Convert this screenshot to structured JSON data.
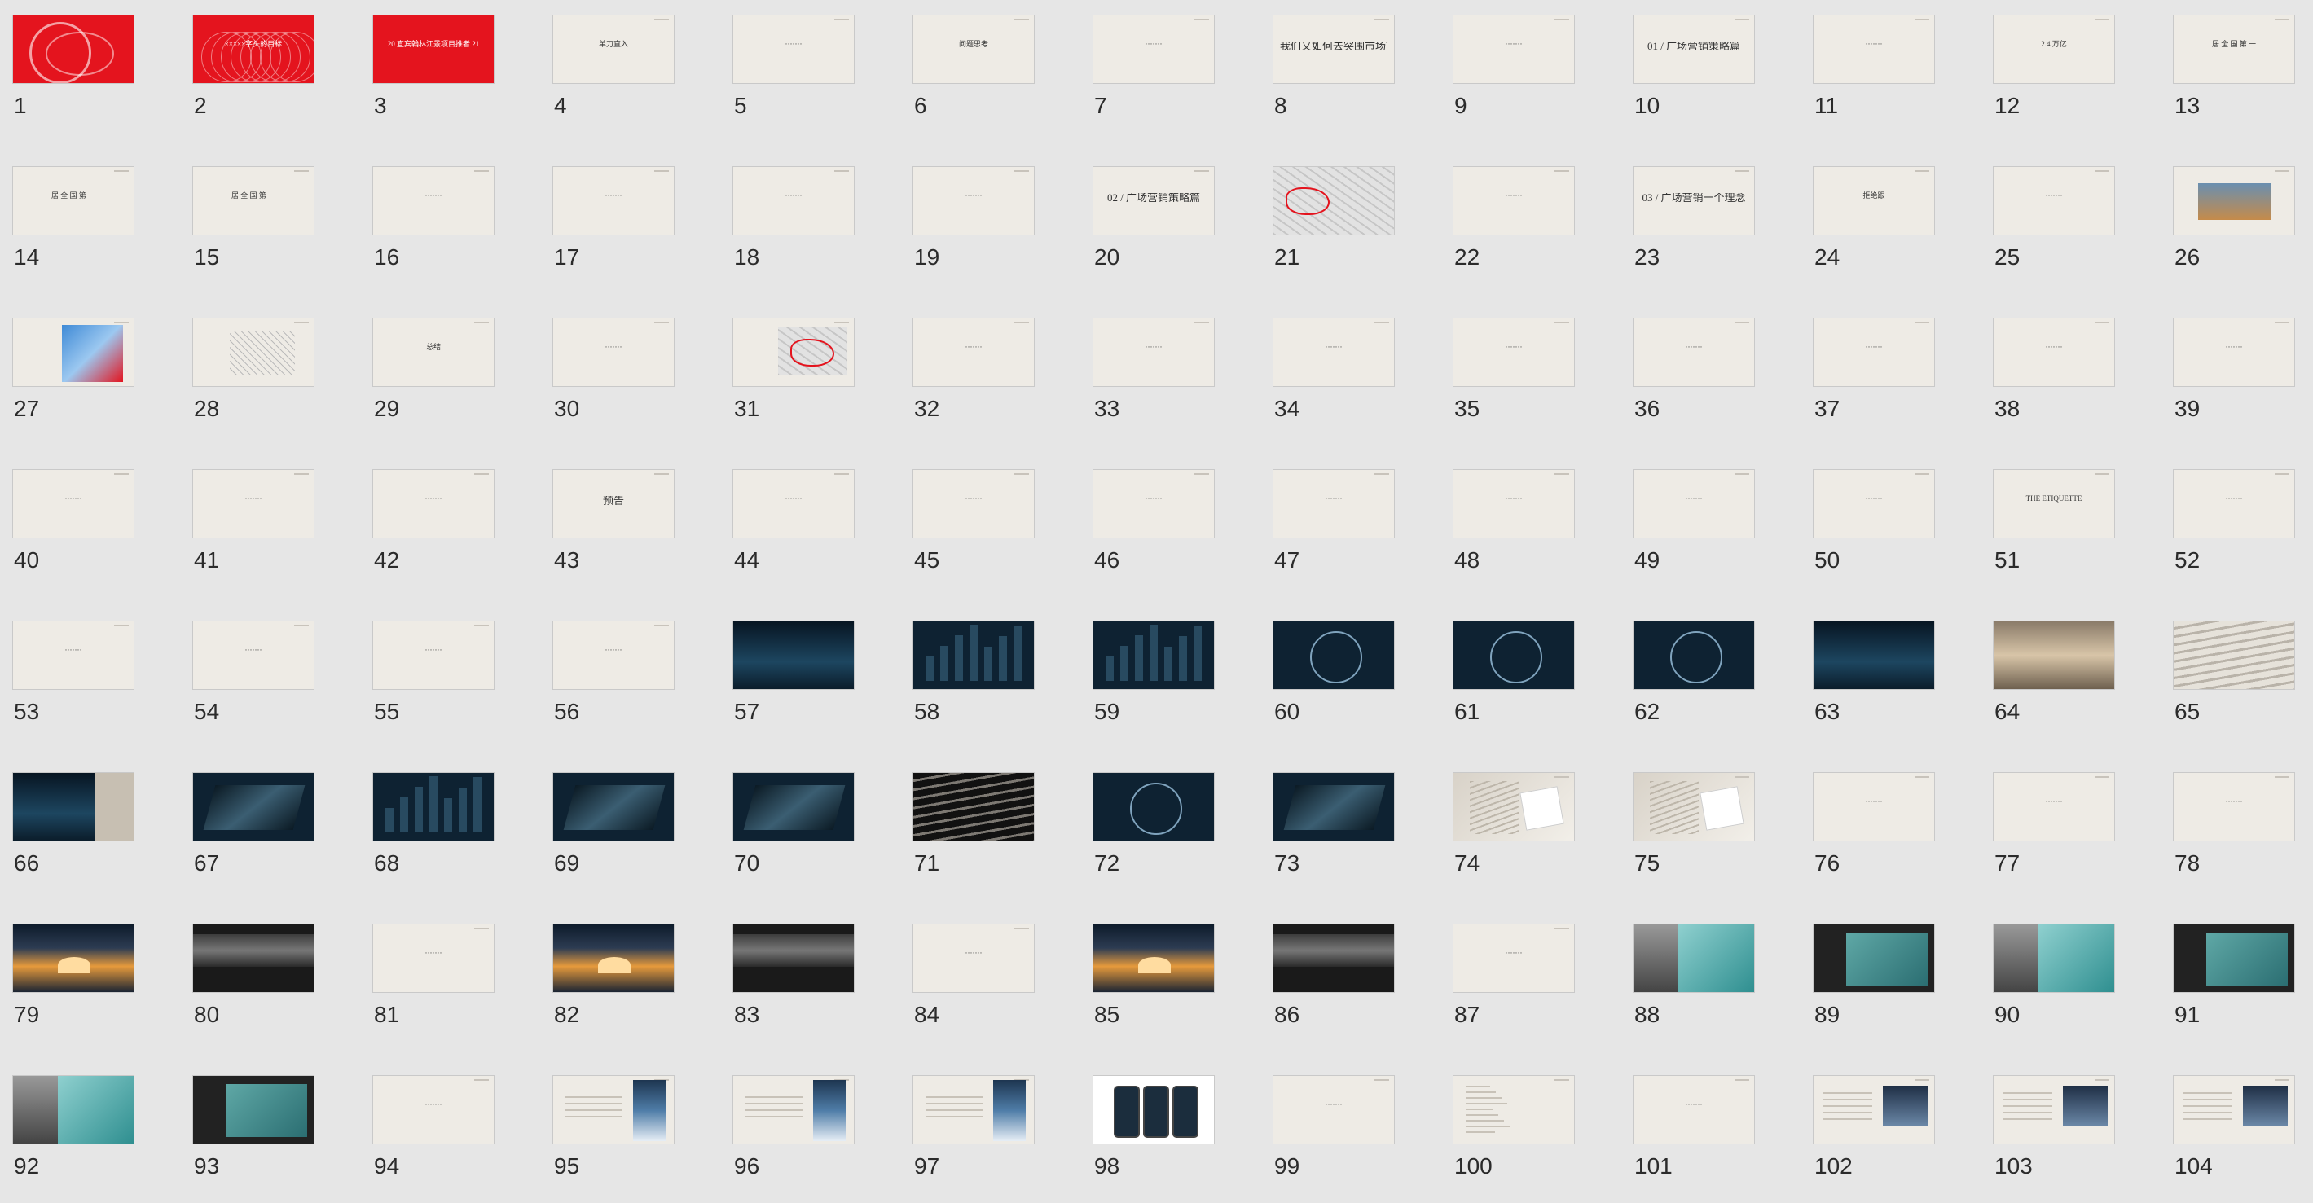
{
  "view": "slide-sorter",
  "columns": 13,
  "colors": {
    "background": "#e6e6e6",
    "slide_paper": "#eeebe5",
    "accent_red": "#e4141e",
    "dark_navy": "#0e2232",
    "teal": "#1f3a4c"
  },
  "slides": [
    {
      "n": "1",
      "style": "red",
      "art": "swirl"
    },
    {
      "n": "2",
      "style": "red",
      "art": "lines",
      "text": "×××××字头的目标"
    },
    {
      "n": "3",
      "style": "red",
      "art": "title",
      "text": "20 宜宾翰林江景项目推者 21"
    },
    {
      "n": "4",
      "style": "paper",
      "text": "单刀直入"
    },
    {
      "n": "5",
      "style": "paper",
      "text": "·······"
    },
    {
      "n": "6",
      "style": "paper",
      "text": "问题思考"
    },
    {
      "n": "7",
      "style": "paper",
      "text": "·······"
    },
    {
      "n": "8",
      "style": "paper",
      "text": "我们又如何去突围市场？",
      "big": true
    },
    {
      "n": "9",
      "style": "paper",
      "text": "·······"
    },
    {
      "n": "10",
      "style": "paper",
      "text": "01 / 广场营销策略篇",
      "big": true
    },
    {
      "n": "11",
      "style": "paper",
      "text": "·······"
    },
    {
      "n": "12",
      "style": "paper",
      "text": "2.4 万亿"
    },
    {
      "n": "13",
      "style": "paper",
      "text": "居 全 国 第 一"
    },
    {
      "n": "14",
      "style": "paper",
      "text": "居 全 国 第 一"
    },
    {
      "n": "15",
      "style": "paper",
      "text": "居 全 国 第 一"
    },
    {
      "n": "16",
      "style": "paper",
      "text": "·······"
    },
    {
      "n": "17",
      "style": "paper",
      "text": "·······"
    },
    {
      "n": "18",
      "style": "paper",
      "text": "·······"
    },
    {
      "n": "19",
      "style": "paper",
      "text": "·······"
    },
    {
      "n": "20",
      "style": "paper",
      "text": "02 / 广场营销策略篇",
      "big": true
    },
    {
      "n": "21",
      "style": "map"
    },
    {
      "n": "22",
      "style": "paper",
      "text": "·······"
    },
    {
      "n": "23",
      "style": "paper",
      "text": "03 / 广场营销一个理念",
      "big": true
    },
    {
      "n": "24",
      "style": "paper",
      "text": "拒绝跟"
    },
    {
      "n": "25",
      "style": "paper",
      "text": "·······"
    },
    {
      "n": "26",
      "style": "paper-photo"
    },
    {
      "n": "27",
      "style": "paper-map"
    },
    {
      "n": "28",
      "style": "paper-sketch"
    },
    {
      "n": "29",
      "style": "paper",
      "text": "总结"
    },
    {
      "n": "30",
      "style": "paper",
      "text": "·······"
    },
    {
      "n": "31",
      "style": "paper-map2"
    },
    {
      "n": "32",
      "style": "paper",
      "text": "·······"
    },
    {
      "n": "33",
      "style": "paper",
      "text": "·······"
    },
    {
      "n": "34",
      "style": "paper",
      "text": "·······"
    },
    {
      "n": "35",
      "style": "paper",
      "text": "·······"
    },
    {
      "n": "36",
      "style": "paper",
      "text": "·······"
    },
    {
      "n": "37",
      "style": "paper",
      "text": "·······"
    },
    {
      "n": "38",
      "style": "paper",
      "text": "·······"
    },
    {
      "n": "39",
      "style": "paper",
      "text": "·······"
    },
    {
      "n": "40",
      "style": "paper",
      "text": "·······"
    },
    {
      "n": "41",
      "style": "paper",
      "text": "·······"
    },
    {
      "n": "42",
      "style": "paper",
      "text": "·······"
    },
    {
      "n": "43",
      "style": "paper",
      "text": "预告",
      "big": true
    },
    {
      "n": "44",
      "style": "paper",
      "text": "·······"
    },
    {
      "n": "45",
      "style": "paper",
      "text": "·······"
    },
    {
      "n": "46",
      "style": "paper",
      "text": "·······"
    },
    {
      "n": "47",
      "style": "paper",
      "text": "·······"
    },
    {
      "n": "48",
      "style": "paper",
      "text": "·······"
    },
    {
      "n": "49",
      "style": "paper",
      "text": "·······"
    },
    {
      "n": "50",
      "style": "paper",
      "text": "·······"
    },
    {
      "n": "51",
      "style": "paper",
      "text": "THE ETIQUETTE"
    },
    {
      "n": "52",
      "style": "paper",
      "text": "·······"
    },
    {
      "n": "53",
      "style": "paper",
      "text": "·······"
    },
    {
      "n": "54",
      "style": "paper",
      "text": "·······"
    },
    {
      "n": "55",
      "style": "paper",
      "text": "·······"
    },
    {
      "n": "56",
      "style": "paper",
      "text": "·······"
    },
    {
      "n": "57",
      "style": "dark-water"
    },
    {
      "n": "58",
      "style": "dark-city"
    },
    {
      "n": "59",
      "style": "dark-city2"
    },
    {
      "n": "60",
      "style": "dark-ring"
    },
    {
      "n": "61",
      "style": "dark-ring"
    },
    {
      "n": "62",
      "style": "dark-glass"
    },
    {
      "n": "63",
      "style": "dark-water"
    },
    {
      "n": "64",
      "style": "sand"
    },
    {
      "n": "65",
      "style": "waves-light"
    },
    {
      "n": "66",
      "style": "dark-water2"
    },
    {
      "n": "67",
      "style": "dark-fold"
    },
    {
      "n": "68",
      "style": "dark-city"
    },
    {
      "n": "69",
      "style": "dark-fold2"
    },
    {
      "n": "70",
      "style": "dark-cards"
    },
    {
      "n": "71",
      "style": "waves-dark"
    },
    {
      "n": "72",
      "style": "waves-ring"
    },
    {
      "n": "73",
      "style": "dark-mix"
    },
    {
      "n": "74",
      "style": "paper-mix"
    },
    {
      "n": "75",
      "style": "paper-mix2"
    },
    {
      "n": "76",
      "style": "paper",
      "text": "·······"
    },
    {
      "n": "77",
      "style": "paper",
      "text": "·······"
    },
    {
      "n": "78",
      "style": "paper",
      "text": "·······"
    },
    {
      "n": "79",
      "style": "sunset"
    },
    {
      "n": "80",
      "style": "dark-banner"
    },
    {
      "n": "81",
      "style": "paper",
      "text": "·······"
    },
    {
      "n": "82",
      "style": "sunset"
    },
    {
      "n": "83",
      "style": "dark-banner2"
    },
    {
      "n": "84",
      "style": "paper",
      "text": "·······"
    },
    {
      "n": "85",
      "style": "sunset"
    },
    {
      "n": "86",
      "style": "dark-banner"
    },
    {
      "n": "87",
      "style": "paper",
      "text": "·······"
    },
    {
      "n": "88",
      "style": "teal-photo"
    },
    {
      "n": "89",
      "style": "dark-teal"
    },
    {
      "n": "90",
      "style": "teal-photo2"
    },
    {
      "n": "91",
      "style": "dark-teal2"
    },
    {
      "n": "92",
      "style": "teal-photo3"
    },
    {
      "n": "93",
      "style": "dark-teal3"
    },
    {
      "n": "94",
      "style": "paper",
      "text": "·······"
    },
    {
      "n": "95",
      "style": "paper-poster"
    },
    {
      "n": "96",
      "style": "paper-poster"
    },
    {
      "n": "97",
      "style": "paper-poster"
    },
    {
      "n": "98",
      "style": "phones"
    },
    {
      "n": "99",
      "style": "paper",
      "text": "·······"
    },
    {
      "n": "100",
      "style": "paper-list"
    },
    {
      "n": "101",
      "style": "paper",
      "text": "·······"
    },
    {
      "n": "102",
      "style": "paper-photo2"
    },
    {
      "n": "103",
      "style": "paper-photo3"
    },
    {
      "n": "104",
      "style": "paper-photo4"
    }
  ]
}
